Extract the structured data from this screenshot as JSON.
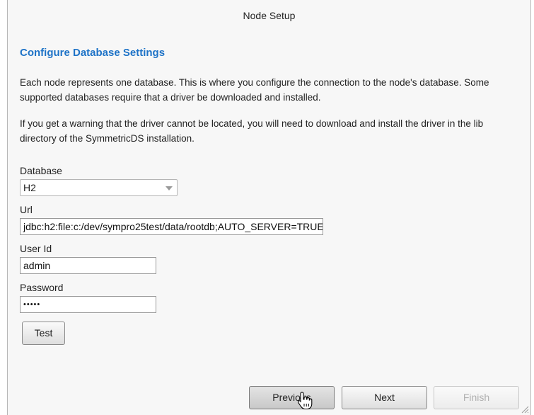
{
  "window": {
    "title": "Node Setup"
  },
  "section": {
    "heading": "Configure Database Settings",
    "paragraph1": "Each node represents one database. This is where you configure the connection to the node's database. Some supported databases require that a driver be downloaded and installed.",
    "paragraph2": "If you get a warning that the driver cannot be located, you will need to download and install the driver in the lib directory of the SymmetricDS installation."
  },
  "form": {
    "database_label": "Database",
    "database_value": "H2",
    "url_label": "Url",
    "url_value": "jdbc:h2:file:c:/dev/sympro25test/data/rootdb;AUTO_SERVER=TRUE",
    "userid_label": "User Id",
    "userid_value": "admin",
    "password_label": "Password",
    "password_value": "•••••",
    "test_label": "Test"
  },
  "footer": {
    "previous_label": "Previous",
    "next_label": "Next",
    "finish_label": "Finish"
  },
  "icons": {
    "cursor": "hand-pointer-icon",
    "dropdown": "chevron-down-icon",
    "resize": "resize-grip-icon"
  }
}
